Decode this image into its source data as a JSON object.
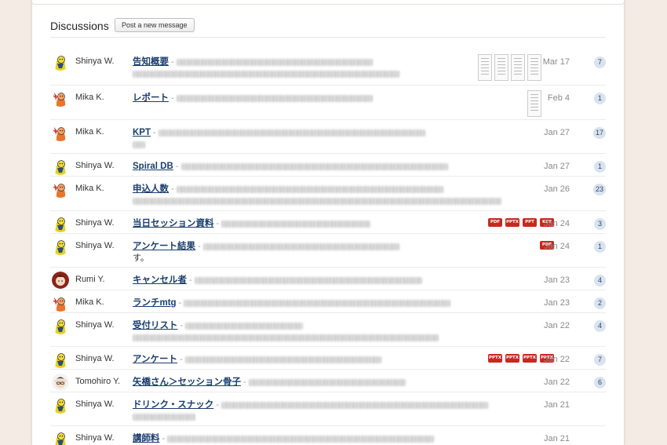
{
  "header": {
    "title": "Discussions",
    "post_button": "Post a new message"
  },
  "messages": [
    {
      "author": "Shinya W.",
      "subject": "告知概要",
      "date": "Mar 17",
      "count": "7",
      "avatar": "yellow",
      "blur": [
        380,
        340
      ],
      "thumbs": 4
    },
    {
      "author": "Mika K.",
      "subject": "レポート",
      "date": "Feb 4",
      "count": "1",
      "avatar": "orange",
      "blur": [
        260
      ],
      "thumbs": 1
    },
    {
      "author": "Mika K.",
      "subject": "KPT",
      "date": "Jan 27",
      "count": "17",
      "avatar": "orange",
      "blur": [
        390,
        16
      ]
    },
    {
      "author": "Shinya W.",
      "subject": "Spiral DB",
      "date": "Jan 27",
      "count": "1",
      "avatar": "yellow",
      "blur": [
        340
      ]
    },
    {
      "author": "Mika K.",
      "subject": "申込人数",
      "date": "Jan 26",
      "count": "23",
      "avatar": "orange",
      "blur": [
        410,
        470
      ]
    },
    {
      "author": "Shinya W.",
      "subject": "当日セッション資料",
      "date": "Jan 24",
      "count": "3",
      "avatar": "yellow",
      "blur": [
        190
      ],
      "files": [
        "PDF",
        "PPTX",
        "PPT",
        "KEY"
      ]
    },
    {
      "author": "Shinya W.",
      "subject": "アンケート結果",
      "date": "Jan 24",
      "count": "1",
      "avatar": "yellow",
      "blur": [
        360
      ],
      "tail": "す。",
      "files": [
        "PDF"
      ]
    },
    {
      "author": "Rumi Y.",
      "subject": "キャンセル者",
      "date": "Jan 23",
      "count": "4",
      "avatar": "red",
      "blur": [
        290
      ]
    },
    {
      "author": "Mika K.",
      "subject": "ランチmtg",
      "date": "Jan 23",
      "count": "2",
      "avatar": "orange",
      "blur": [
        390
      ]
    },
    {
      "author": "Shinya W.",
      "subject": "受付リスト",
      "date": "Jan 22",
      "count": "4",
      "avatar": "yellow",
      "blur": [
        150,
        390
      ]
    },
    {
      "author": "Shinya W.",
      "subject": "アンケート",
      "date": "Jan 22",
      "count": "7",
      "avatar": "yellow",
      "blur": [
        270
      ],
      "files": [
        "PPTX",
        "PPTX",
        "PPTX",
        "PPTX"
      ]
    },
    {
      "author": "Tomohiro Y.",
      "subject": "矢橋さん＞セッション骨子",
      "date": "Jan 22",
      "count": "6",
      "avatar": "dark",
      "blur": [
        200
      ]
    },
    {
      "author": "Shinya W.",
      "subject": "ドリンク・スナック",
      "date": "Jan 21",
      "count": "",
      "avatar": "yellow",
      "blur": [
        380,
        80
      ]
    },
    {
      "author": "Shinya W.",
      "subject": "講師料",
      "date": "Jan 21",
      "count": "",
      "avatar": "yellow",
      "blur": [
        420
      ]
    }
  ],
  "colors": {
    "background": "#f4ece4",
    "link": "#1a3d6e",
    "count_badge": "#d9e3ef"
  }
}
